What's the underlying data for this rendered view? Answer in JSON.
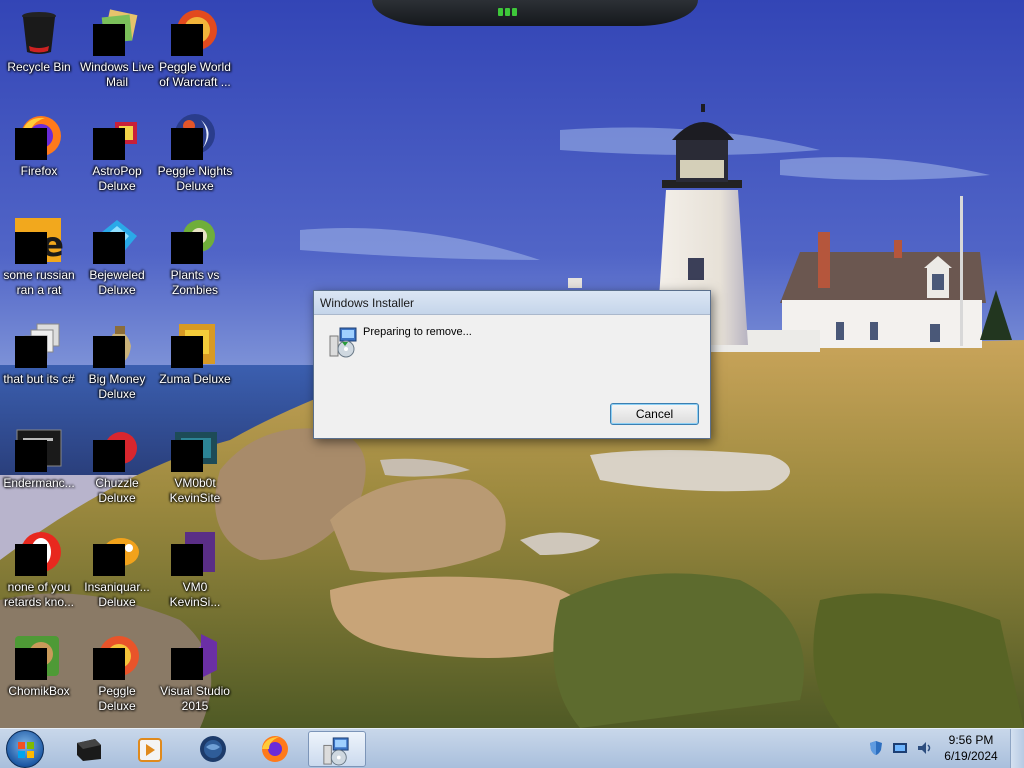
{
  "desktop": {
    "icons": [
      {
        "id": "recycle-bin",
        "label": "Recycle Bin",
        "icon": "recycle-bin-icon"
      },
      {
        "id": "windows-live-mail",
        "label": "Windows Live Mail",
        "icon": "windows-live-mail-icon"
      },
      {
        "id": "peggle-world-of-warcraft",
        "label": "Peggle World of Warcraft ...",
        "icon": "peggle-wow-icon"
      },
      {
        "id": "firefox",
        "label": "Firefox",
        "icon": "firefox-icon"
      },
      {
        "id": "astropop-deluxe",
        "label": "AstroPop Deluxe",
        "icon": "astropop-icon"
      },
      {
        "id": "peggle-nights-deluxe",
        "label": "Peggle Nights Deluxe",
        "icon": "peggle-nights-icon"
      },
      {
        "id": "some-russian-ran-a-rat",
        "label": "some russian ran a rat",
        "icon": "java-file-icon"
      },
      {
        "id": "bejeweled-deluxe",
        "label": "Bejeweled Deluxe",
        "icon": "bejeweled-icon"
      },
      {
        "id": "plants-vs-zombies",
        "label": "Plants vs Zombies",
        "icon": "plants-vs-zombies-icon"
      },
      {
        "id": "that-but-its-csharp",
        "label": "that but its c#",
        "icon": "stacked-windows-icon"
      },
      {
        "id": "big-money-deluxe",
        "label": "Big Money Deluxe",
        "icon": "big-money-icon"
      },
      {
        "id": "zuma-deluxe",
        "label": "Zuma Deluxe",
        "icon": "zuma-icon"
      },
      {
        "id": "endermanc",
        "label": "Endermanc...",
        "icon": "terminal-icon"
      },
      {
        "id": "chuzzle-deluxe",
        "label": "Chuzzle Deluxe",
        "icon": "chuzzle-icon"
      },
      {
        "id": "vm0b0t-kevinsite",
        "label": "VM0b0t KevinSite",
        "icon": "vm-icon"
      },
      {
        "id": "none-of-you",
        "label": "none of you retards kno...",
        "icon": "opera-icon"
      },
      {
        "id": "insaniquarium-deluxe",
        "label": "Insaniquar... Deluxe",
        "icon": "insaniquarium-icon"
      },
      {
        "id": "vm0-kevinsi",
        "label": "VM0 KevinSi...",
        "icon": "vm-purple-icon"
      },
      {
        "id": "chomikbox",
        "label": "ChomikBox",
        "icon": "chomikbox-icon"
      },
      {
        "id": "peggle-deluxe",
        "label": "Peggle Deluxe",
        "icon": "peggle-icon"
      },
      {
        "id": "visual-studio-2015",
        "label": "Visual Studio 2015",
        "icon": "visual-studio-icon"
      }
    ]
  },
  "dialog": {
    "title": "Windows Installer",
    "message": "Preparing to remove...",
    "cancel_label": "Cancel"
  },
  "taskbar": {
    "pinned": [
      {
        "id": "start",
        "icon": "windows-start-icon"
      },
      {
        "id": "app-black-box",
        "icon": "black-box-icon"
      },
      {
        "id": "media-player",
        "icon": "media-player-icon"
      },
      {
        "id": "globe-app",
        "icon": "globe-icon"
      },
      {
        "id": "firefox",
        "icon": "firefox-icon"
      },
      {
        "id": "windows-installer",
        "icon": "installer-icon",
        "active": true
      }
    ],
    "tray": {
      "time": "9:56 PM",
      "date": "6/19/2024"
    }
  },
  "colors": {
    "sky_top": "#3447b8",
    "sky_bottom": "#8fa3df",
    "taskbar": "#b9cbe3",
    "dialog_bg": "#f0f0f0",
    "button_focus": "#3c7fb1"
  }
}
